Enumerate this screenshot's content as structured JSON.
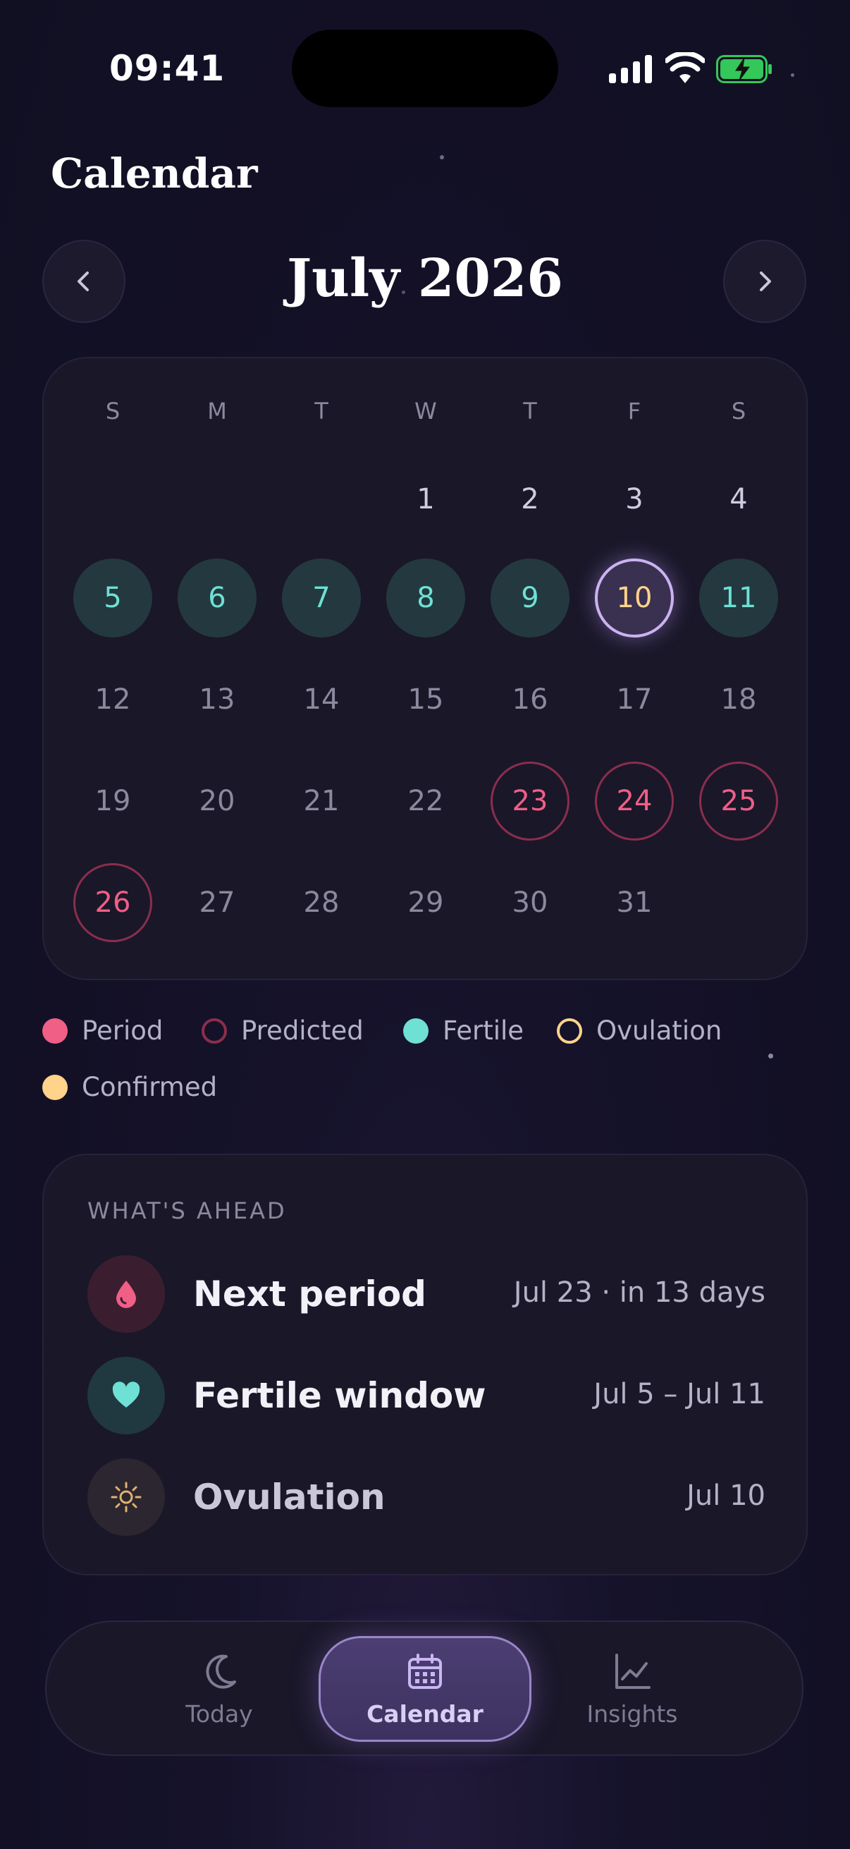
{
  "status": {
    "time": "09:41"
  },
  "header": {
    "title": "Calendar"
  },
  "month": {
    "label": "July 2026"
  },
  "weekdays": [
    "S",
    "M",
    "T",
    "W",
    "T",
    "F",
    "S"
  ],
  "days": {
    "d1": "1",
    "d2": "2",
    "d3": "3",
    "d4": "4",
    "d5": "5",
    "d6": "6",
    "d7": "7",
    "d8": "8",
    "d9": "9",
    "d10": "10",
    "d11": "11",
    "d12": "12",
    "d13": "13",
    "d14": "14",
    "d15": "15",
    "d16": "16",
    "d17": "17",
    "d18": "18",
    "d19": "19",
    "d20": "20",
    "d21": "21",
    "d22": "22",
    "d23": "23",
    "d24": "24",
    "d25": "25",
    "d26": "26",
    "d27": "27",
    "d28": "28",
    "d29": "29",
    "d30": "30",
    "d31": "31"
  },
  "legend": {
    "period": "Period",
    "predicted": "Predicted",
    "fertile": "Fertile",
    "ovulation": "Ovulation",
    "confirmed": "Confirmed"
  },
  "ahead": {
    "title": "WHAT'S AHEAD",
    "next_period": {
      "label": "Next period",
      "value": "Jul 23 · in 13 days"
    },
    "fertile_window": {
      "label": "Fertile window",
      "value": "Jul 5 – Jul 11"
    },
    "ovulation": {
      "label": "Ovulation",
      "value": "Jul 10"
    }
  },
  "tabs": {
    "today": "Today",
    "calendar": "Calendar",
    "insights": "Insights"
  },
  "colors": {
    "period": "#ef5f86",
    "fertile": "#6fe0d4",
    "ovulation": "#ffd38a",
    "accent": "#cbb2f0"
  },
  "icons": {
    "prev": "chevron-left-icon",
    "next": "chevron-right-icon",
    "next_period": "drop-icon",
    "fertile_window": "heart-icon",
    "ovulation": "sun-icon",
    "today_tab": "moon-icon",
    "calendar_tab": "calendar-icon",
    "insights_tab": "chart-line-icon"
  }
}
